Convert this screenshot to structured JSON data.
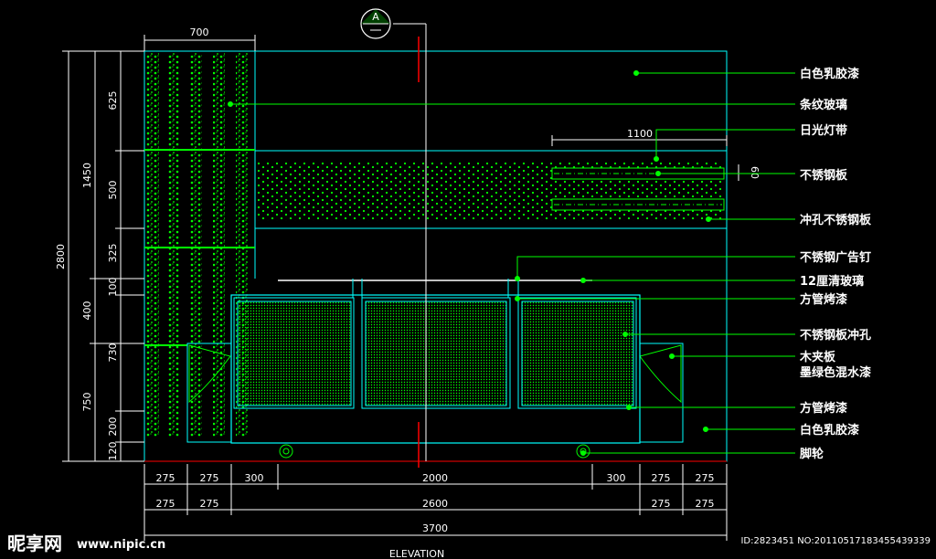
{
  "marker": {
    "letter": "A"
  },
  "top_dim": "700",
  "left_dims": {
    "overall": "2800",
    "middle": [
      "1450",
      "400",
      "750"
    ],
    "inner": [
      "625",
      "500",
      "325",
      "100",
      "730",
      "200",
      "120"
    ]
  },
  "dim_1100": "1100",
  "dim_60": "60",
  "bottom_row1": [
    "275",
    "275",
    "300",
    "2000",
    "300",
    "275",
    "275"
  ],
  "bottom_row2": [
    "275",
    "275",
    "2600",
    "275",
    "275"
  ],
  "bottom_total": "3700",
  "title": "ELEVATION",
  "labels": [
    "白色乳胶漆",
    "条纹玻璃",
    "日光灯带",
    "不锈钢板",
    "冲孔不锈钢板",
    "不锈钢广告钉",
    "12厘清玻璃",
    "方管烤漆",
    "不锈钢板冲孔",
    "木夹板",
    "墨绿色混水漆",
    "方管烤漆",
    "白色乳胶漆",
    "脚轮"
  ],
  "watermark": {
    "logo": "昵享网",
    "site": "www.nipic.cn",
    "id": "ID:2823451 NO:20110517183455439339"
  },
  "colors": {
    "background": "#000000",
    "outline": "#00ffff",
    "hatch": "#00ff00",
    "dimension": "#ffffff",
    "axis": "#ff0000"
  }
}
